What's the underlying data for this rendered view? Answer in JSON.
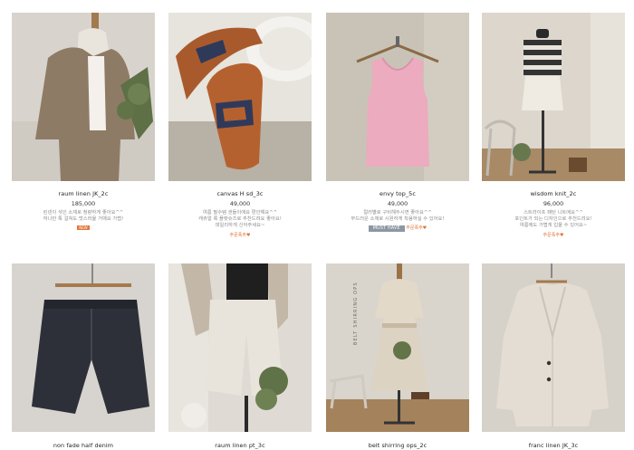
{
  "products": [
    {
      "name": "raum linen JK_2c",
      "price": "185,000",
      "desc": [
        "린넨이 섞인 소재로 청량하게 좋아요^^",
        "하나만 툭 걸쳐도 멋스러울 거예요 가볍!"
      ],
      "badge": "NEW",
      "image_icon": "linen-jacket-mannequin"
    },
    {
      "name": "canvas H sd_3c",
      "price": "49,000",
      "desc": [
        "여름 필수템 샌들이에요 편안해요^^",
        "캐쥬얼 룩 플랫슈즈로 추천드려요 좋아요!",
        "데일리하게 신어주세요~"
      ],
      "recommend": "주문폭주♥",
      "image_icon": "sandals"
    },
    {
      "name": "envy top_5c",
      "price": "49,000",
      "desc": [
        "컬러별로 구비해두시면 좋아요^^",
        "부드러운 소재로 시원하게 착용하실 수 있어요!"
      ],
      "must_have": "MUST HAVE",
      "recommend": "주문폭주♥",
      "image_icon": "pink-knit-top"
    },
    {
      "name": "wisdom knit_2c",
      "price": "96,000",
      "desc": [
        "스트라이프 패턴 니트에요^^",
        "포인트가 되는 디자인으로 추천드려요!",
        "여름에도 가볍게 입을 수 있어요~"
      ],
      "recommend": "주문폭주♥",
      "image_icon": "striped-knit-mannequin"
    },
    {
      "name": "non fade half denim",
      "image_icon": "denim-shorts"
    },
    {
      "name": "raum linen pt_3c",
      "image_icon": "linen-pants"
    },
    {
      "name": "belt shirring ops_2c",
      "image_icon": "belted-dress",
      "overlay": "BELT SHIRRING OPS"
    },
    {
      "name": "franc linen JK_3c",
      "image_icon": "linen-blazer"
    }
  ]
}
